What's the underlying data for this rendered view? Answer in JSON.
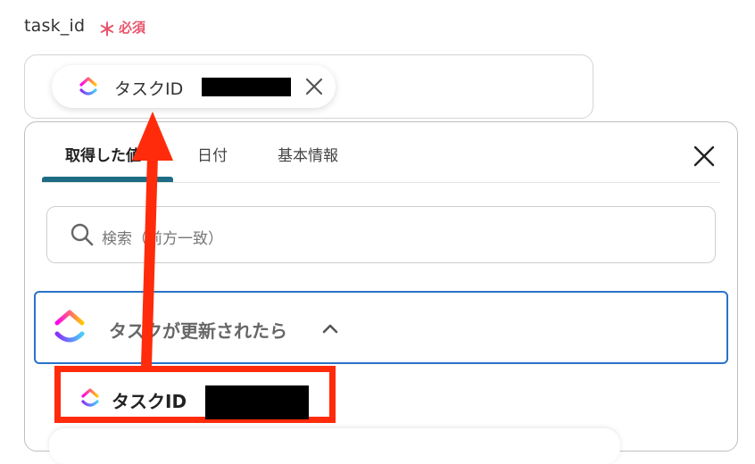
{
  "field": {
    "label": "task_id",
    "required_star": "＊",
    "required_text": "必須"
  },
  "selected_chip": {
    "label": "タスクID",
    "icon": "clickup-logo-icon",
    "remove_icon": "close-icon"
  },
  "panel": {
    "tabs": [
      {
        "label": "取得した値",
        "active": true
      },
      {
        "label": "日付",
        "active": false
      },
      {
        "label": "基本情報",
        "active": false
      }
    ],
    "close_icon": "close-icon",
    "search": {
      "placeholder": "検索（前方一致）",
      "icon": "search-icon"
    },
    "group": {
      "label": "タスクが更新されたら",
      "icon": "clickup-logo-icon",
      "chevron": "chevron-up-icon"
    },
    "items": [
      {
        "label": "タスクID",
        "icon": "clickup-logo-icon",
        "highlighted": true
      }
    ]
  },
  "colors": {
    "required": "#e8536b",
    "tab_active_underline": "#1d6c84",
    "group_border": "#2a72c8",
    "annotation_red": "#ff2b0a"
  }
}
